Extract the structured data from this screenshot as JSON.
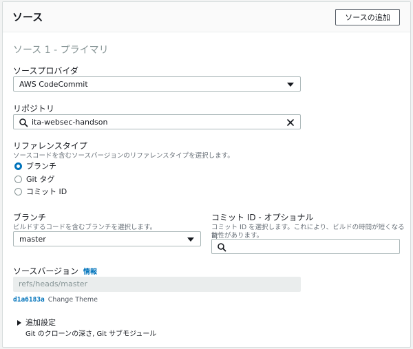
{
  "panel": {
    "title": "ソース",
    "add_button": "ソースの追加"
  },
  "section": {
    "title": "ソース 1 - プライマリ"
  },
  "provider": {
    "label": "ソースプロバイダ",
    "value": "AWS CodeCommit"
  },
  "repository": {
    "label": "リポジトリ",
    "value": "ita-websec-handson"
  },
  "reference_type": {
    "label": "リファレンスタイプ",
    "description": "ソースコードを含むソースバージョンのリファレンスタイプを選択します。",
    "options": [
      {
        "label": "ブランチ",
        "selected": true
      },
      {
        "label": "Git タグ",
        "selected": false
      },
      {
        "label": "コミット ID",
        "selected": false
      }
    ]
  },
  "branch": {
    "label": "ブランチ",
    "description": "ビルドするコードを含むブランチを選択します。",
    "value": "master"
  },
  "commit_id": {
    "label": "コミット ID - オプショナル",
    "description_line1": "コミット ID を選択します。これにより、ビルドの時間が短くなる可",
    "description_line2": "能性があります。",
    "value": ""
  },
  "source_version": {
    "label": "ソースバージョン",
    "info_link": "情報",
    "value": "refs/heads/master",
    "commit_hash": "d1a6183a",
    "commit_message": "Change Theme"
  },
  "additional": {
    "label": "追加設定",
    "description": "Git のクローンの深さ, Git サブモジュール"
  },
  "colors": {
    "accent": "#0073bb",
    "text": "#16191f",
    "muted": "#687078"
  }
}
